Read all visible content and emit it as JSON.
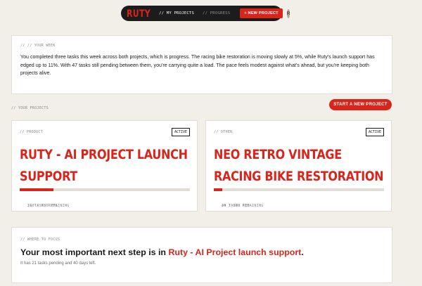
{
  "nav": {
    "logo": "RUTY",
    "my_projects": "// MY PROJECTS",
    "progress": "// PROGRESS",
    "new_project": "+ NEW PROJECT",
    "avatar_initial": "R"
  },
  "week": {
    "eyebrow": "// // YOUR WEEK",
    "summary": "You completed three tasks this week across both projects, which is progress. The racing bike restoration is moving slowly at 5%, while Ruty's launch support has edged up to 11%. With 47 tasks still pending between them, you're carrying quite a load. The pace feels modest against what's ahead, but you're keeping both projects alive."
  },
  "projects_section": {
    "label": "// YOUR PROJECTS",
    "start_button": "START A NEW PROJECT"
  },
  "projects": [
    {
      "category": "// PRODUCT",
      "status": "ACTIVE",
      "title": "RUTY - AI PROJECT LAUNCH SUPPORT",
      "points": "140 / 700 PTS",
      "remaining": "21 TASKS REMAINING",
      "progress": 0.2
    },
    {
      "category": "// OTHER",
      "status": "ACTIVE",
      "title": "NEO RETRO VINTAGE RACING BIKE RESTORATION",
      "points": "40 / 800 PTS",
      "remaining": "24 TASKS REMAINING",
      "progress": 0.05
    }
  ],
  "focus": {
    "eyebrow": "// WHERE TO FOCUS",
    "heading_prefix": "Your most important next step is in ",
    "heading_project": "Ruty - AI Project launch support",
    "heading_suffix": ".",
    "detail": "It has 21 tasks pending and 40 days left."
  },
  "colors": {
    "accent": "#d8251c",
    "background": "#f2efe9",
    "nav_bg": "#1c1c1c"
  }
}
